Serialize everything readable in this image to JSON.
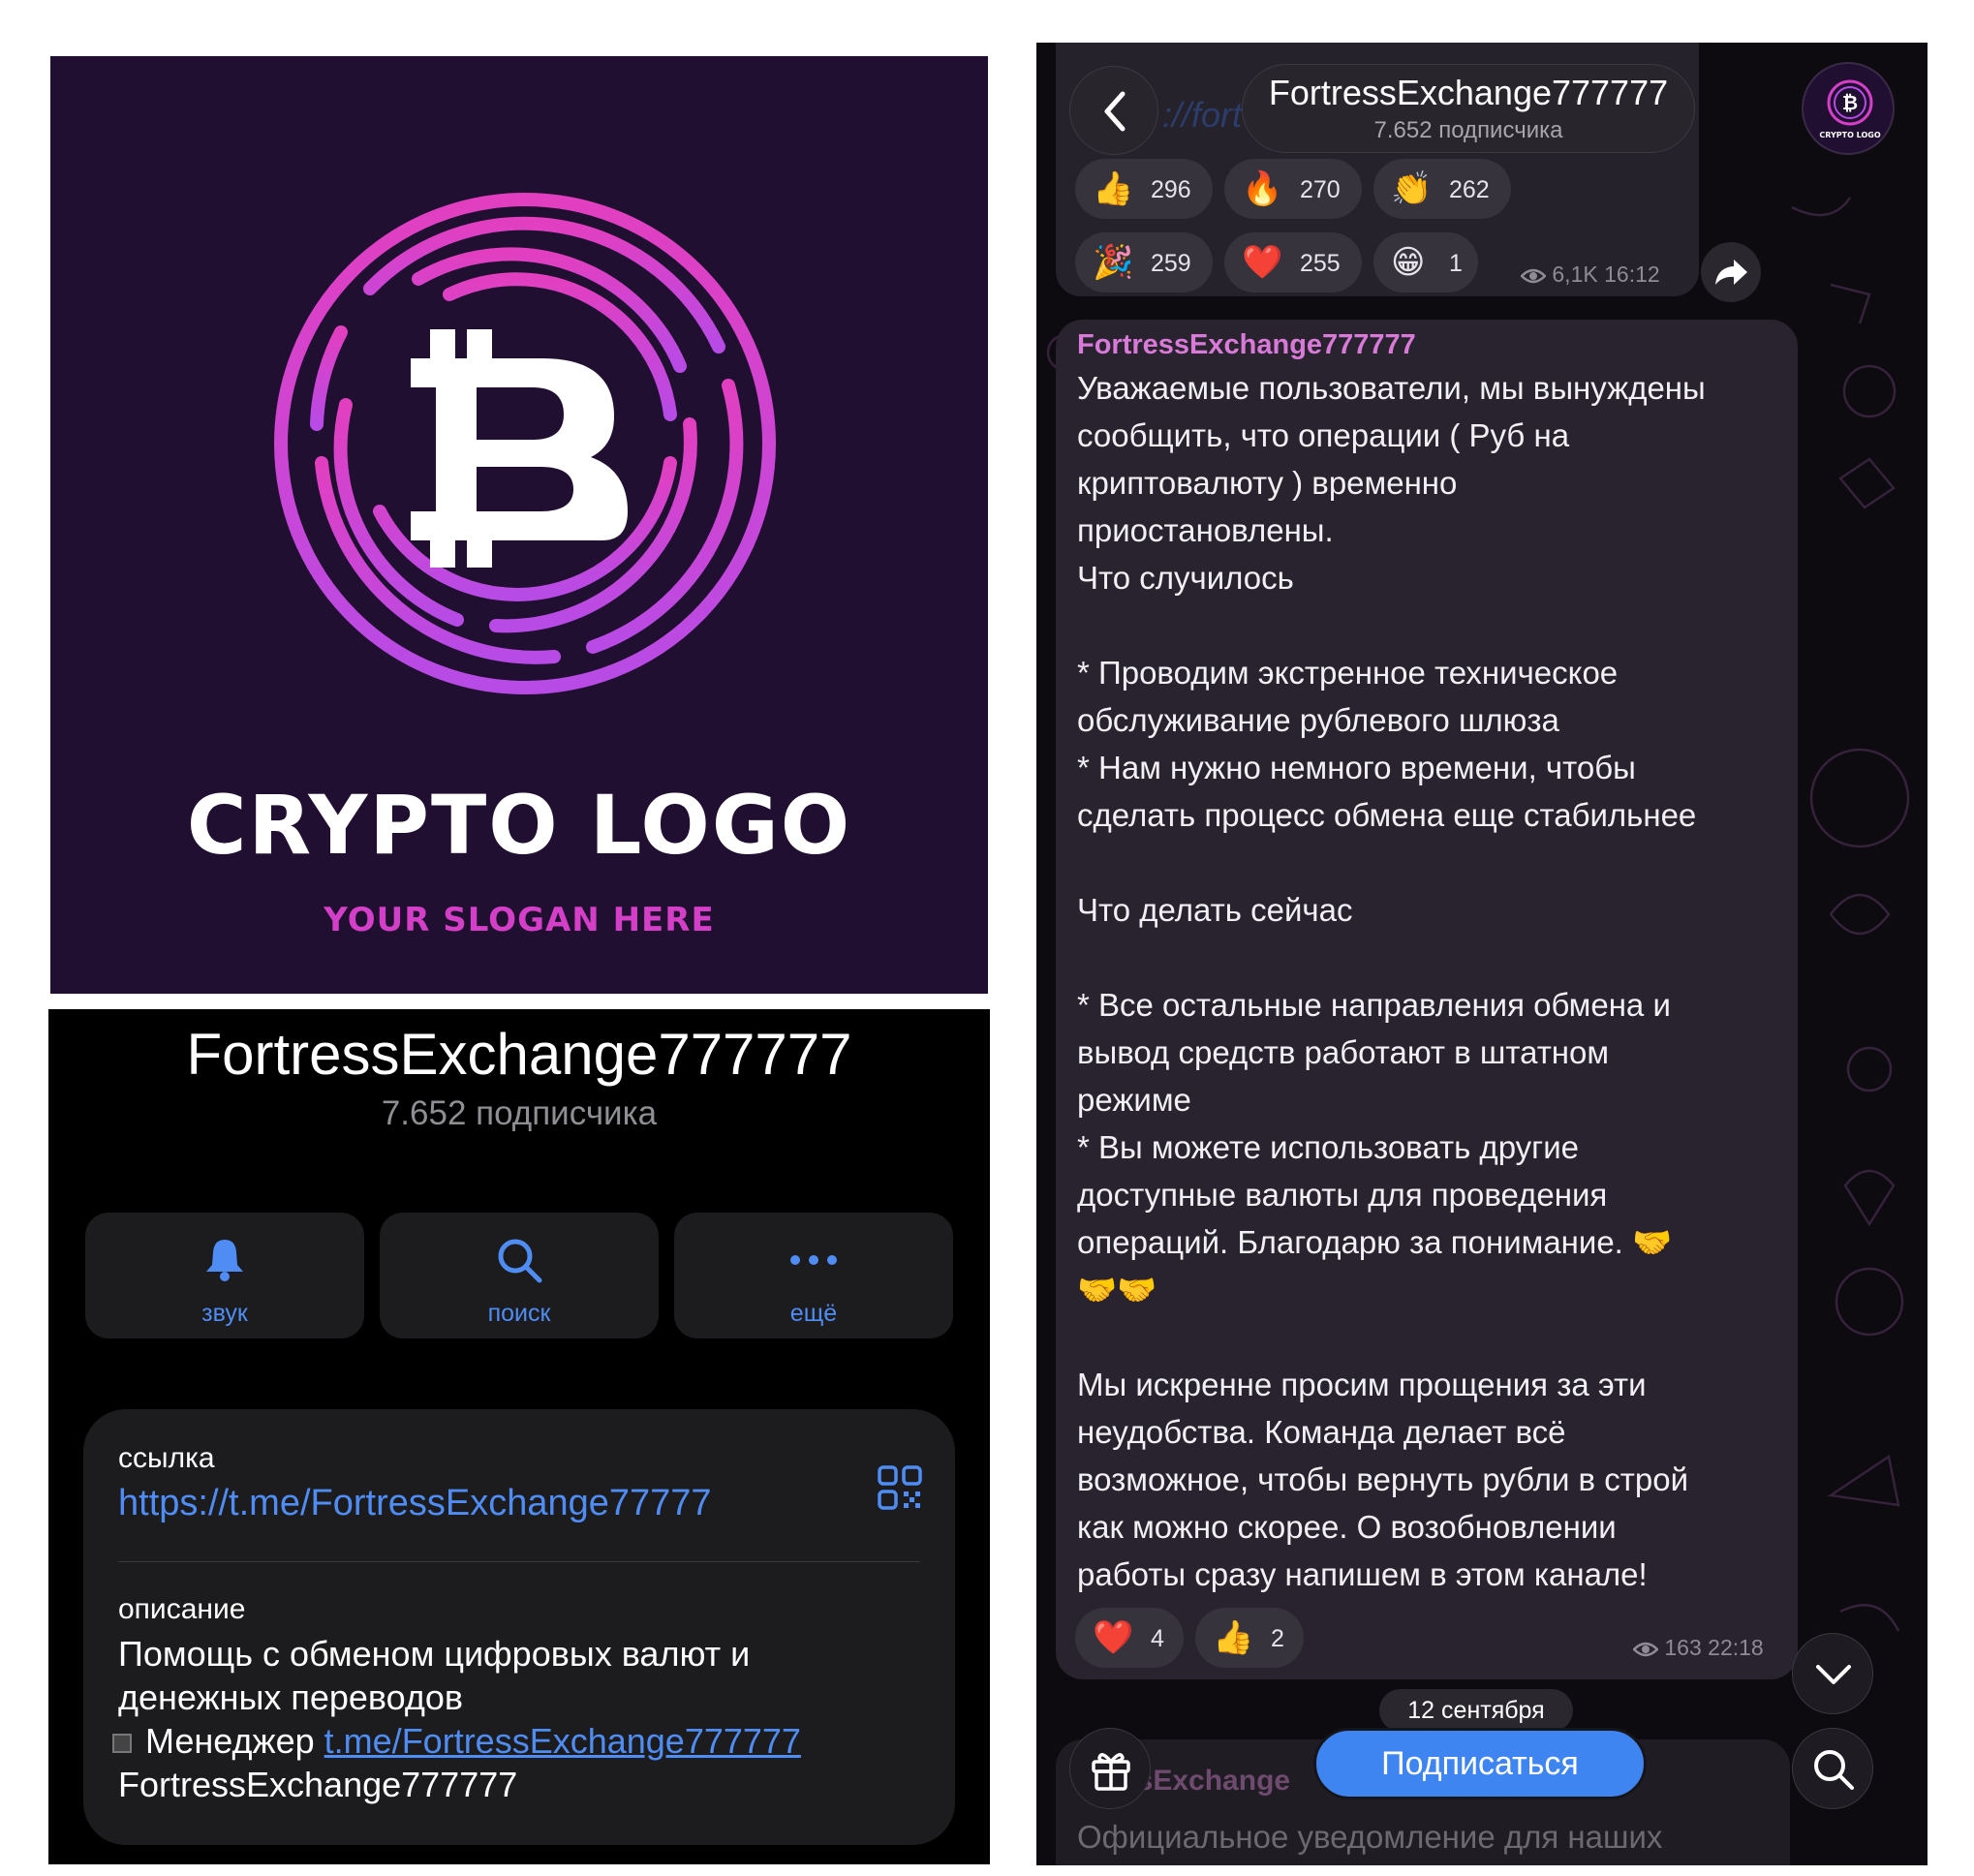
{
  "logo": {
    "title": "CRYPTO LOGO",
    "slogan": "YOUR SLOGAN HERE",
    "colors": {
      "background": "#200f31",
      "ring": "#d43fc8",
      "glyph": "#ffffff"
    }
  },
  "profile": {
    "channel_name": "FortressExchange777777",
    "subscribers": "7.652 подписчика",
    "actions": [
      {
        "icon": "bell-icon",
        "label": "звук"
      },
      {
        "icon": "search-icon",
        "label": "поиск"
      },
      {
        "icon": "more-icon",
        "label": "ещё"
      }
    ],
    "link_label": "ссылка",
    "link_url": "https://t.me/FortressExchange77777",
    "description_label": "описание",
    "description_line1": "Помощь с обменом цифровых валют и",
    "description_line2": "денежных переводов",
    "manager_prefix": "Менеджер",
    "manager_link": "t.me/FortressExchange777777",
    "description_line4": "FortressExchange777777",
    "accent_color": "#4f8df5"
  },
  "chat": {
    "header": {
      "title": "FortressExchange777777",
      "subtitle": "7.652 подписчика",
      "ghost_url": "://fort"
    },
    "avatar": {
      "title": "CRYPTO LOGO"
    },
    "prev_message": {
      "reactions": [
        {
          "emoji": "👍",
          "count": "296"
        },
        {
          "emoji": "🔥",
          "count": "270"
        },
        {
          "emoji": "👏",
          "count": "262"
        },
        {
          "emoji": "🎉",
          "count": "259"
        },
        {
          "emoji": "❤️",
          "count": "255"
        },
        {
          "emoji": "😁",
          "count": "1"
        }
      ],
      "views": "6,1K",
      "time": "16:12"
    },
    "message": {
      "author": "FortressExchange777777",
      "lines": [
        "Уважаемые пользователи, мы вынуждены",
        "сообщить, что операции ( Руб на",
        "криптовалюту ) временно",
        "приостановлены.",
        "Что случилось",
        "",
        "* Проводим экстренное техническое",
        "обслуживание рублевого шлюза",
        "* Нам нужно немного времени, чтобы",
        "сделать процесс обмена еще стабильнее",
        "",
        "Что делать сейчас",
        "",
        "* Все остальные направления обмена и",
        "вывод средств работают в штатном",
        "режиме",
        "* Вы можете использовать другие",
        "доступные валюты для проведения",
        "операций. Благодарю за понимание. 🤝",
        "🤝🤝",
        "",
        "Мы искренне просим прощения за эти",
        "неудобства. Команда делает всё",
        "возможное, чтобы вернуть рубли в строй",
        "как можно скорее. О возобновлении",
        "работы сразу напишем в этом канале!"
      ],
      "reactions": [
        {
          "emoji": "❤️",
          "count": "4"
        },
        {
          "emoji": "👍",
          "count": "2"
        }
      ],
      "views": "163",
      "time": "22:18"
    },
    "date_separator": "12 сентября",
    "next_message": {
      "author_partial": "Fo    ssExchange",
      "text_partial": "Официальное уведомление для наших"
    },
    "subscribe_label": "Подписаться",
    "subscribe_color": "#3e85f2"
  }
}
